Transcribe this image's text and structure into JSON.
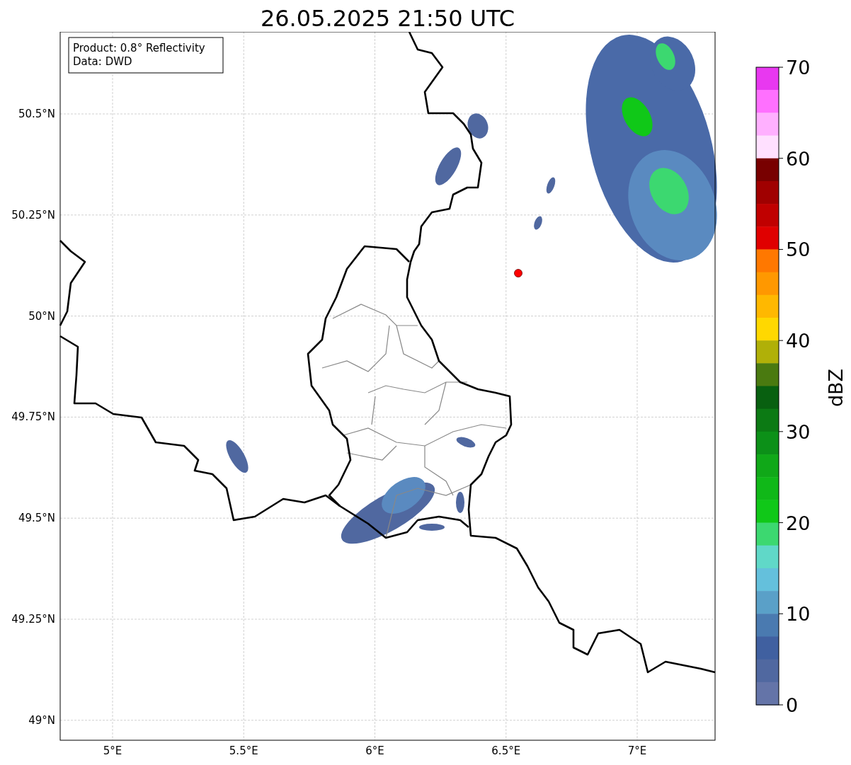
{
  "title": "26.05.2025 21:50 UTC",
  "info_box": {
    "lines": [
      "Product: 0.8° Reflectivity",
      "Data: DWD"
    ]
  },
  "map": {
    "x_ticks": [
      "5°E",
      "5.5°E",
      "6°E",
      "6.5°E",
      "7°E"
    ],
    "y_ticks": [
      "50.5°N",
      "50.25°N",
      "50°N",
      "49.75°N",
      "49.5°N",
      "49.25°N",
      "49°N"
    ]
  },
  "colorbar": {
    "label": "dBZ",
    "ticks": [
      "70",
      "60",
      "50",
      "40",
      "30",
      "20",
      "10",
      "0"
    ],
    "bins": [
      {
        "color": "#e838f0"
      },
      {
        "color": "#ff70ff"
      },
      {
        "color": "#ffb0ff"
      },
      {
        "color": "#ffe0ff"
      },
      {
        "color": "#780000"
      },
      {
        "color": "#a00000"
      },
      {
        "color": "#c00000"
      },
      {
        "color": "#e00000"
      },
      {
        "color": "#ff7800"
      },
      {
        "color": "#ff9800"
      },
      {
        "color": "#ffb800"
      },
      {
        "color": "#ffd800"
      },
      {
        "color": "#b0b008"
      },
      {
        "color": "#4a7a10"
      },
      {
        "color": "#086010"
      },
      {
        "color": "#0c7a14"
      },
      {
        "color": "#0c9018"
      },
      {
        "color": "#10a818"
      },
      {
        "color": "#10b818"
      },
      {
        "color": "#10c818"
      },
      {
        "color": "#3cd870"
      },
      {
        "color": "#60d8c8"
      },
      {
        "color": "#64c0dc"
      },
      {
        "color": "#5aa0c8"
      },
      {
        "color": "#4a7ab0"
      },
      {
        "color": "#4060a0"
      },
      {
        "color": "#5068a0"
      },
      {
        "color": "#6474a8"
      }
    ]
  }
}
